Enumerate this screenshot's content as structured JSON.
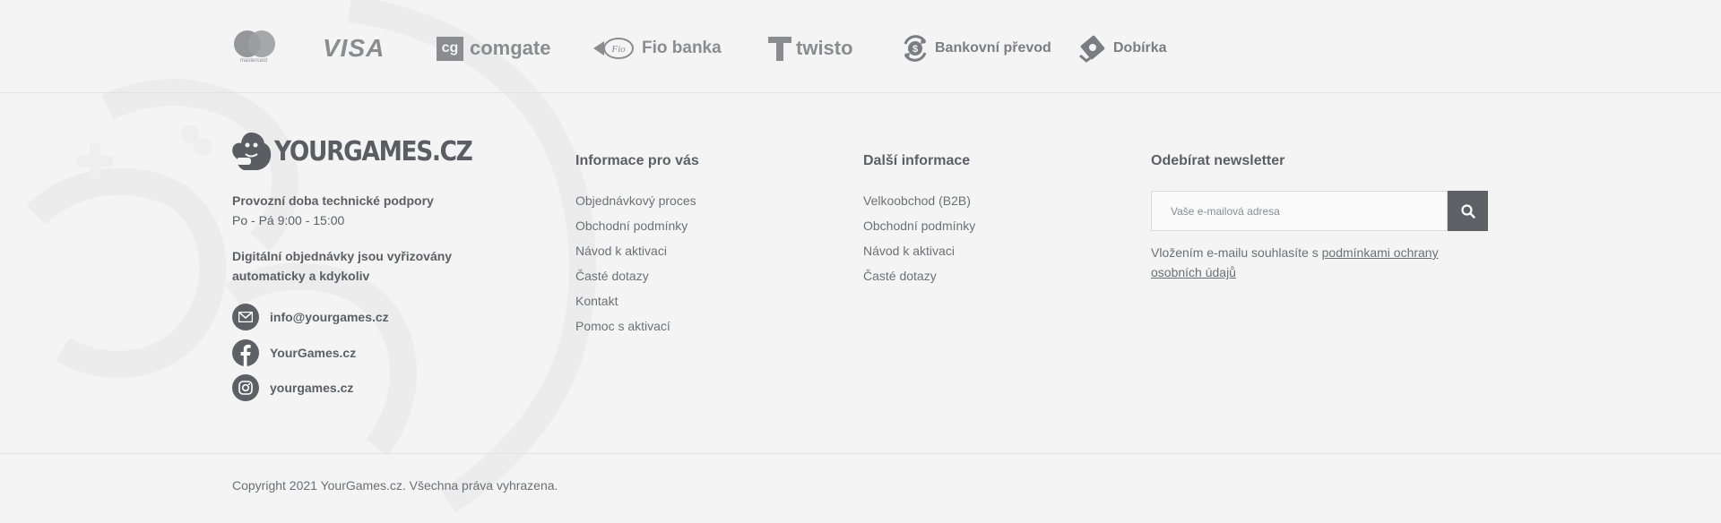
{
  "payments": {
    "mastercard": "mastercard",
    "visa": "VISA",
    "comgate_box": "cg",
    "comgate": "comgate",
    "fio_badge": "Fio",
    "fio": "Fio banka",
    "twisto": "twisto",
    "bank_transfer": "Bankovní převod",
    "cod": "Dobírka"
  },
  "brand": {
    "logo": "YOURGAMES.CZ"
  },
  "support": {
    "title": "Provozní doba technické podpory",
    "hours": "Po - Pá 9:00 - 15:00",
    "digital": "Digitální objednávky jsou vyřizovány automaticky a kdykoliv"
  },
  "contacts": [
    {
      "icon": "mail-icon",
      "label": "info@yourgames.cz"
    },
    {
      "icon": "facebook-icon",
      "label": "YourGames.cz"
    },
    {
      "icon": "instagram-icon",
      "label": "yourgames.cz"
    }
  ],
  "info_col": {
    "title": "Informace pro vás",
    "links": [
      "Objednávkový proces",
      "Obchodní podmínky",
      "Návod k aktivaci",
      "Časté dotazy",
      "Kontakt",
      "Pomoc s aktivací"
    ]
  },
  "more_col": {
    "title": "Další informace",
    "links": [
      "Velkoobchod (B2B)",
      "Obchodní podmínky",
      "Návod k aktivaci",
      "Časté dotazy"
    ]
  },
  "newsletter": {
    "title": "Odebírat newsletter",
    "placeholder": "Vaše e-mailová adresa",
    "note_prefix": "Vložením e-mailu souhlasíte s ",
    "note_link": "podmínkami ochrany osobních údajů"
  },
  "copyright": "Copyright 2021 YourGames.cz. Všechna práva vyhrazena.",
  "colors": {
    "icon_bg": "#5d6166",
    "text": "#5b5f64",
    "background": "#f4f4f4"
  }
}
